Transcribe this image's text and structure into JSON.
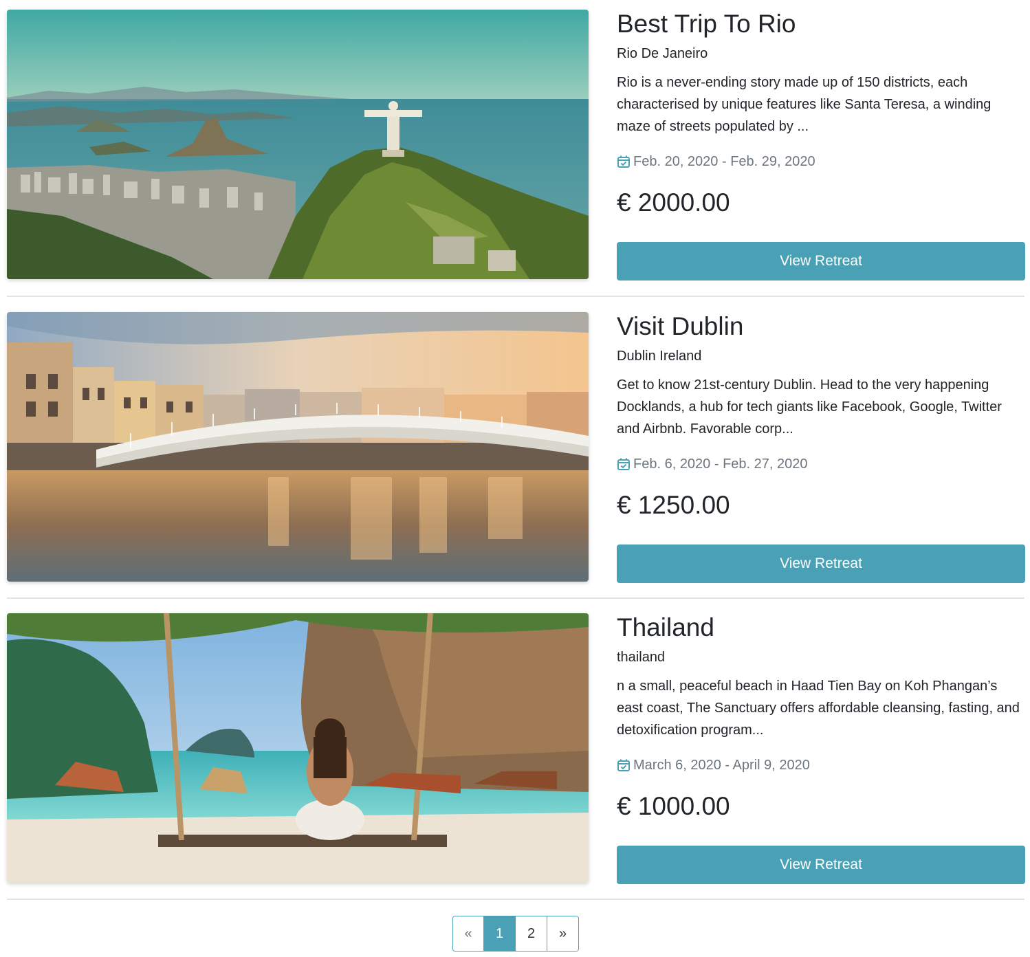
{
  "retreats": [
    {
      "title": "Best Trip To Rio",
      "location": "Rio De Janeiro",
      "description": "Rio is a never-ending story made up of 150 districts, each characterised by unique features like Santa Teresa, a winding maze of streets populated by ...",
      "dates": "Feb. 20, 2020 - Feb. 29, 2020",
      "price": "€ 2000.00",
      "button_label": "View Retreat",
      "image_alt": "Christ the Redeemer overlooking Rio de Janeiro bay"
    },
    {
      "title": "Visit Dublin",
      "location": "Dublin Ireland",
      "description": "Get to know 21st-century Dublin. Head to the very happening Docklands, a hub for tech giants like Facebook, Google, Twitter and Airbnb. Favorable corp...",
      "dates": "Feb. 6, 2020 - Feb. 27, 2020",
      "price": "€ 1250.00",
      "button_label": "View Retreat",
      "image_alt": "Ha'penny Bridge over the River Liffey at sunset"
    },
    {
      "title": "Thailand",
      "location": "thailand",
      "description": "n a small, peaceful beach in Haad Tien Bay on Koh Phangan’s east coast, The Sanctuary offers affordable cleansing, fasting, and detoxification program...",
      "dates": "March 6, 2020 - April 9, 2020",
      "price": "€ 1000.00",
      "button_label": "View Retreat",
      "image_alt": "Woman meditating on a rope swing on a Thai beach with longtail boats"
    }
  ],
  "pagination": {
    "prev": "«",
    "pages": [
      "1",
      "2"
    ],
    "active_page": "1",
    "next": "»"
  },
  "colors": {
    "accent": "#4aa1b5",
    "text": "#212529",
    "muted": "#6c757d",
    "divider": "#e2e5e8"
  },
  "icons": {
    "date": "calendar-check-icon"
  }
}
